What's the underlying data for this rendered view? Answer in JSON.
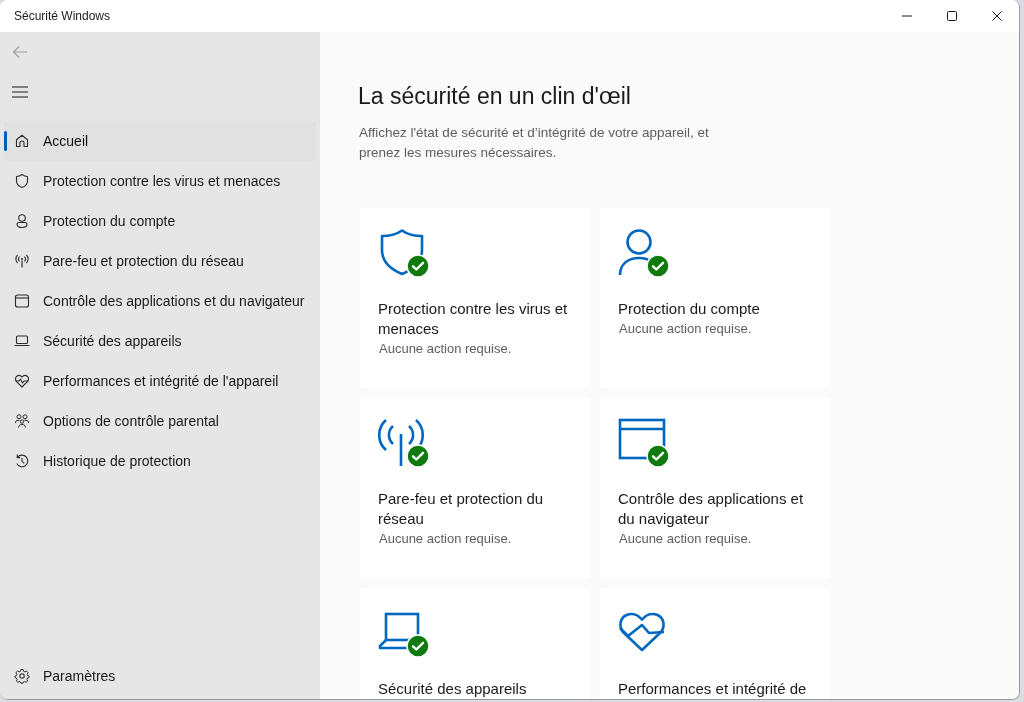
{
  "window": {
    "title": "Sécurité Windows"
  },
  "sidebar": {
    "back_button": {
      "disabled": true
    },
    "items": [
      {
        "label": "Accueil",
        "selected": true
      },
      {
        "label": "Protection contre les virus et menaces",
        "selected": false
      },
      {
        "label": "Protection du compte",
        "selected": false
      },
      {
        "label": "Pare-feu et protection du réseau",
        "selected": false
      },
      {
        "label": "Contrôle des applications et du navigateur",
        "selected": false
      },
      {
        "label": "Sécurité des appareils",
        "selected": false
      },
      {
        "label": "Performances et intégrité de l'appareil",
        "selected": false
      },
      {
        "label": "Options de contrôle parental",
        "selected": false
      },
      {
        "label": "Historique de protection",
        "selected": false
      }
    ],
    "footer_item": {
      "label": "Paramètres"
    }
  },
  "main": {
    "heading": "La sécurité en un clin d'œil",
    "description": "Affichez l'état de sécurité et d’intégrité de votre appareil, et prenez les mesures nécessaires.",
    "cards": [
      {
        "title": "Protection contre les virus et menaces",
        "status": "Aucune action requise.",
        "ok": true
      },
      {
        "title": "Protection du compte",
        "status": "Aucune action requise.",
        "ok": true
      },
      {
        "title": "Pare-feu et protection du réseau",
        "status": "Aucune action requise.",
        "ok": true
      },
      {
        "title": "Contrôle des applications et du navigateur",
        "status": "Aucune action requise.",
        "ok": true
      },
      {
        "title": "Sécurité des appareils",
        "ok": true
      },
      {
        "title": "Performances et intégrité de",
        "ok": false
      }
    ]
  }
}
